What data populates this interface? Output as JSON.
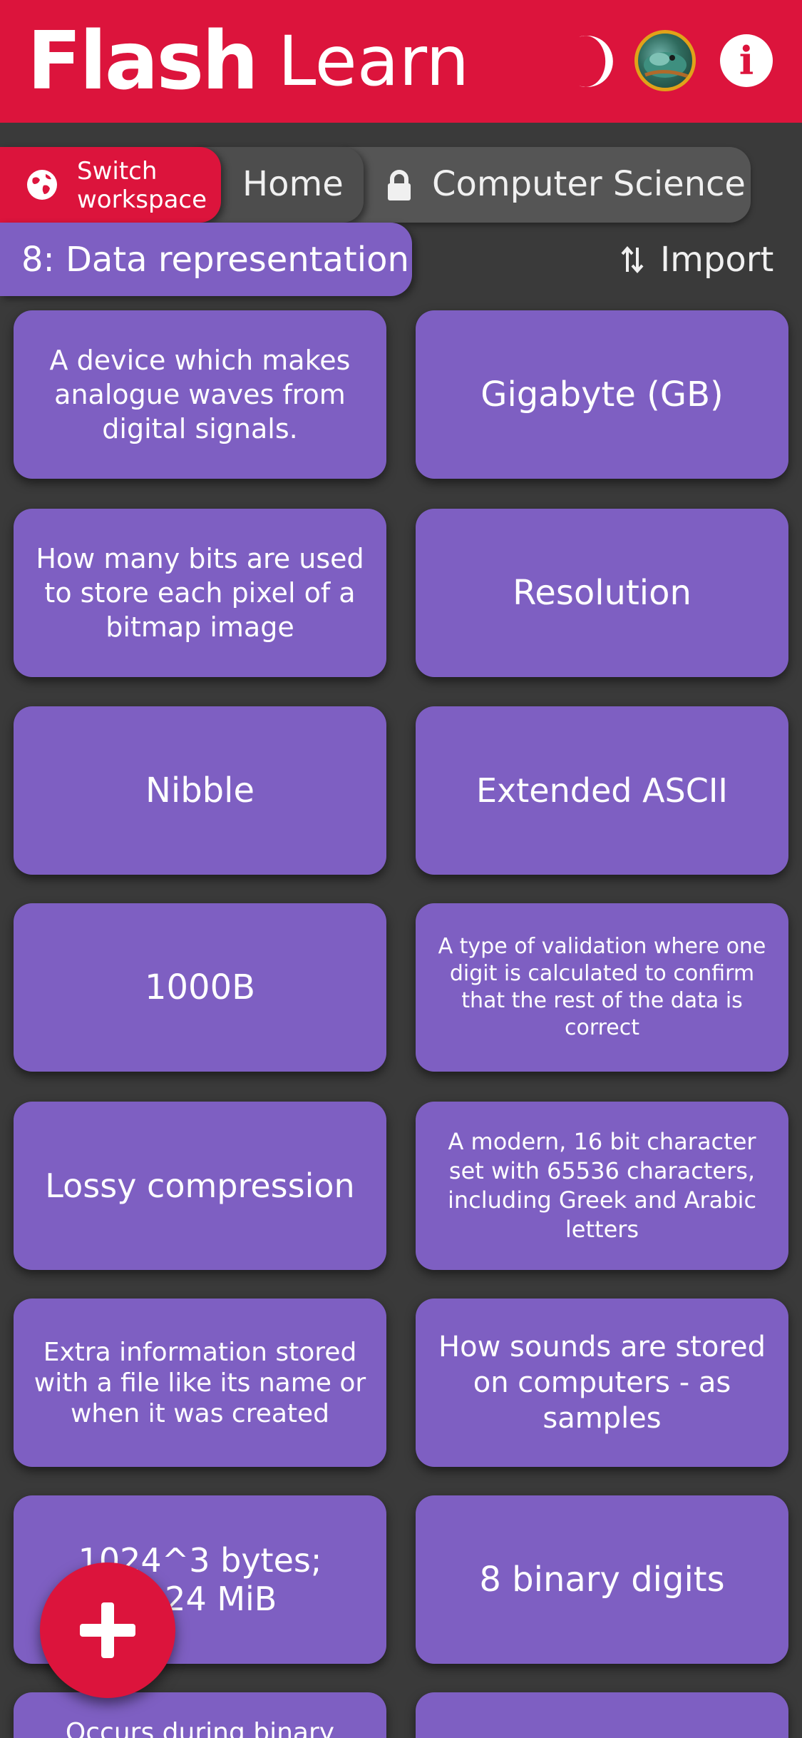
{
  "header": {
    "brand_flash": "Flash",
    "brand_learn": "Learn",
    "icons": [
      "moon-icon",
      "avatar",
      "info-icon"
    ],
    "info_symbol": "i"
  },
  "breadcrumb": {
    "switch_line1": "Switch",
    "switch_line2": "workspace",
    "home": "Home",
    "course": "Computer Science"
  },
  "deck": {
    "title": "8: Data representation",
    "import_label": "Import"
  },
  "cards": [
    "A device which makes analogue waves from digital signals.",
    "Gigabyte (GB)",
    "How many bits are used to store each pixel of a bitmap image",
    "Resolution",
    "Nibble",
    "Extended ASCII",
    "1000B",
    "A type of validation where one digit is calculated to confirm that the rest of the data is correct",
    "Lossy compression",
    "A modern, 16 bit character set with 65536 characters, including Greek and Arabic letters",
    "Extra information stored with a file like its name or when it was created",
    "How sounds are stored on computers - as samples",
    "1024^3 bytes; 1024 MiB",
    "8 binary digits",
    "Occurs during binary",
    ""
  ],
  "colors": {
    "accent": "#dc143c",
    "card": "#7e5fc2",
    "background": "#3a3a3a"
  }
}
